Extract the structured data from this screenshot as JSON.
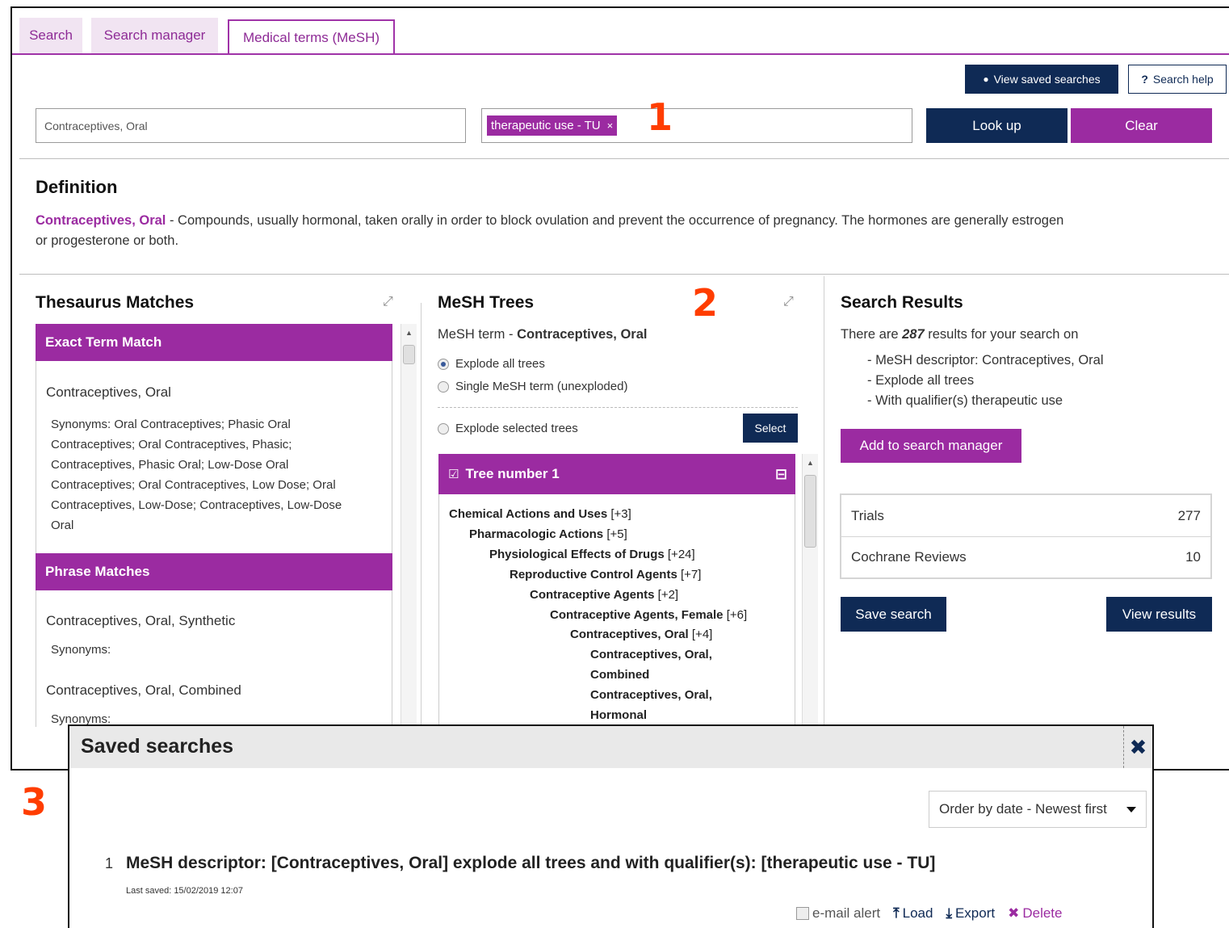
{
  "tabs": [
    {
      "label": "Search"
    },
    {
      "label": "Search manager"
    },
    {
      "label": "Medical terms (MeSH)"
    }
  ],
  "toolbar": {
    "view_saved_label": "View saved searches",
    "help_label": "Search help"
  },
  "search": {
    "term_value": "Contraceptives, Oral",
    "qualifier_chip": "therapeutic use - TU",
    "lookup_label": "Look up",
    "clear_label": "Clear"
  },
  "markers": {
    "m1": "1",
    "m2": "2",
    "m3": "3"
  },
  "definition": {
    "heading": "Definition",
    "term": "Contraceptives, Oral",
    "text_line1": " - Compounds, usually hormonal, taken orally in order to block ovulation and prevent the occurrence of pregnancy. The hormones are generally estrogen",
    "text_line2": "or progesterone or both."
  },
  "thesaurus": {
    "heading": "Thesaurus Matches",
    "exact_header": "Exact Term Match",
    "exact_term": "Contraceptives, Oral",
    "synonyms_lines": [
      "Synonyms: Oral Contraceptives; Phasic Oral",
      "Contraceptives; Oral Contraceptives, Phasic;",
      "Contraceptives, Phasic Oral; Low-Dose Oral",
      "Contraceptives; Oral Contraceptives, Low Dose; Oral",
      "Contraceptives, Low-Dose; Contraceptives, Low-Dose",
      "Oral"
    ],
    "phrase_header": "Phrase Matches",
    "phrase1": "Contraceptives, Oral, Synthetic",
    "phrase1_syn": "Synonyms:",
    "phrase2": "Contraceptives, Oral, Combined",
    "phrase2_syn": "Synonyms:"
  },
  "mesh": {
    "heading": "MeSH Trees",
    "term_prefix": "MeSH term - ",
    "term": "Contraceptives, Oral",
    "opt_explode_all": "Explode all trees",
    "opt_single": "Single MeSH term (unexploded)",
    "opt_selected": "Explode selected trees",
    "select_label": "Select",
    "tree_header": "Tree number 1",
    "tree": [
      {
        "label": "Chemical Actions and Uses",
        "count": "[+3]"
      },
      {
        "label": "Pharmacologic Actions",
        "count": "[+5]"
      },
      {
        "label": "Physiological Effects of Drugs",
        "count": "[+24]"
      },
      {
        "label": "Reproductive Control Agents",
        "count": "[+7]"
      },
      {
        "label": "Contraceptive Agents",
        "count": "[+2]"
      },
      {
        "label": "Contraceptive Agents, Female",
        "count": "[+6]"
      },
      {
        "label": "Contraceptives, Oral",
        "count": "[+4]"
      }
    ],
    "leaf1_a": "Contraceptives, Oral,",
    "leaf1_b": "Combined",
    "leaf2_a": "Contraceptives, Oral,",
    "leaf2_b": "Hormonal"
  },
  "results": {
    "heading": "Search Results",
    "line_prefix": "There are ",
    "count": "287",
    "line_suffix": " results for your search on",
    "criteria": [
      "- MeSH descriptor: Contraceptives, Oral",
      "- Explode all trees",
      "- With qualifier(s) therapeutic use"
    ],
    "add_label": "Add to search manager",
    "rows": [
      {
        "label": "Trials",
        "value": "277"
      },
      {
        "label": "Cochrane Reviews",
        "value": "10"
      }
    ],
    "save_label": "Save search",
    "view_label": "View results"
  },
  "saved_modal": {
    "title": "Saved searches",
    "order_label": "Order by date - Newest first",
    "item_index": "1",
    "item_text": "MeSH descriptor: [Contraceptives, Oral] explode all trees and with qualifier(s): [therapeutic use - TU]",
    "last_saved": "Last saved: 15/02/2019 12:07",
    "email_alert": "e-mail alert",
    "load": "Load",
    "export": "Export",
    "delete": "Delete"
  },
  "colors": {
    "purple": "#9b2ba1",
    "navy": "#0f2a55",
    "marker": "#ff3d00"
  }
}
